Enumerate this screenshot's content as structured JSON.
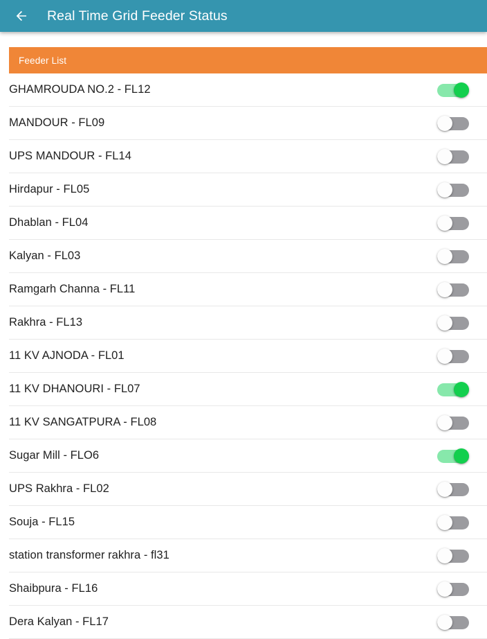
{
  "appbar": {
    "back_icon": "arrow-left-icon",
    "title": "Real Time Grid Feeder Status",
    "background_color": "#3595af",
    "title_color": "#ffffff"
  },
  "card": {
    "header_title": "Feeder List",
    "header_color": "#f08637",
    "header_text_color": "#ffffff"
  },
  "toggle_colors": {
    "on_track": "#87e8ab",
    "on_knob": "#13cf4e",
    "off_track": "#9b9b9f",
    "off_knob": "#fdfdfd"
  },
  "feeders": [
    {
      "name": "GHAMROUDA NO.2 - FL12",
      "state": "on"
    },
    {
      "name": "MANDOUR - FL09",
      "state": "off"
    },
    {
      "name": "UPS MANDOUR - FL14",
      "state": "off"
    },
    {
      "name": "Hirdapur - FL05",
      "state": "off"
    },
    {
      "name": "Dhablan - FL04",
      "state": "off"
    },
    {
      "name": "Kalyan - FL03",
      "state": "off"
    },
    {
      "name": "Ramgarh Channa - FL11",
      "state": "off"
    },
    {
      "name": "Rakhra - FL13",
      "state": "off"
    },
    {
      "name": "11 KV AJNODA - FL01",
      "state": "off"
    },
    {
      "name": "11 KV DHANOURI - FL07",
      "state": "on"
    },
    {
      "name": "11 KV SANGATPURA - FL08",
      "state": "off"
    },
    {
      "name": "Sugar Mill - FLO6",
      "state": "on"
    },
    {
      "name": "UPS Rakhra - FL02",
      "state": "off"
    },
    {
      "name": "Souja - FL15",
      "state": "off"
    },
    {
      "name": "station transformer rakhra - fl31",
      "state": "off"
    },
    {
      "name": "Shaibpura - FL16",
      "state": "off"
    },
    {
      "name": "Dera Kalyan - FL17",
      "state": "off"
    }
  ]
}
